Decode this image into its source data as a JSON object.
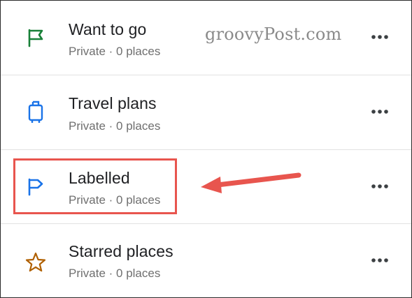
{
  "watermark": "groovyPost.com",
  "lists": [
    {
      "title": "Want to go",
      "subtitle": "Private · 0 places",
      "icon": "flag-icon",
      "icon_color": "#188038"
    },
    {
      "title": "Travel plans",
      "subtitle": "Private · 0 places",
      "icon": "suitcase-icon",
      "icon_color": "#1a73e8"
    },
    {
      "title": "Labelled",
      "subtitle": "Private · 0 places",
      "icon": "label-flag-icon",
      "icon_color": "#1a73e8"
    },
    {
      "title": "Starred places",
      "subtitle": "Private · 0 places",
      "icon": "star-icon",
      "icon_color": "#b06000"
    }
  ],
  "annotation_color": "#e8554e",
  "more_icon": "more-horizontal-icon"
}
